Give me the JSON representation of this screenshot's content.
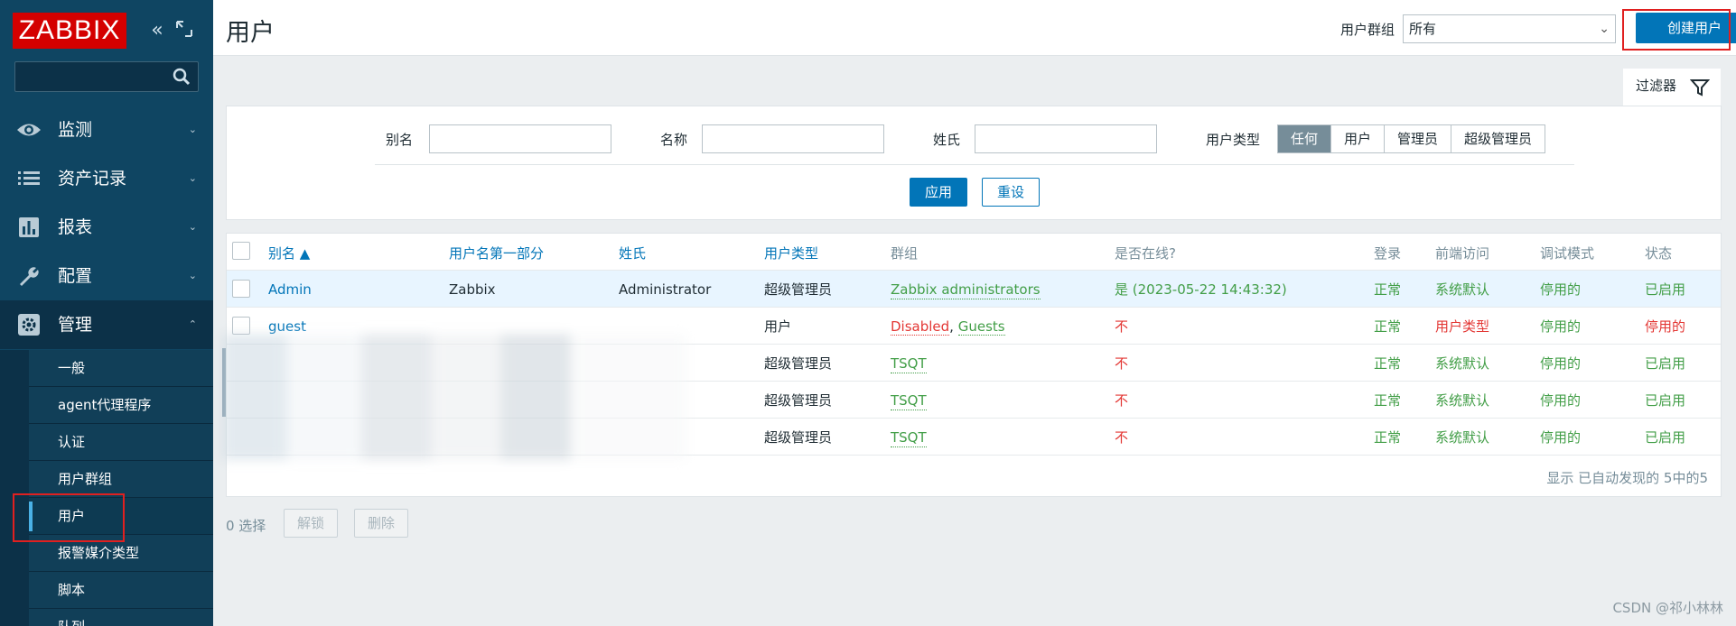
{
  "sidebar": {
    "logo": "ZABBIX",
    "search": {
      "value": "",
      "placeholder": ""
    },
    "menu": [
      {
        "label": "监测",
        "icon": "eye-icon"
      },
      {
        "label": "资产记录",
        "icon": "list-icon"
      },
      {
        "label": "报表",
        "icon": "bar-chart-icon"
      },
      {
        "label": "配置",
        "icon": "wrench-icon"
      },
      {
        "label": "管理",
        "icon": "gear-icon"
      }
    ],
    "submenu": [
      "一般",
      "agent代理程序",
      "认证",
      "用户群组",
      "用户",
      "报警媒介类型",
      "脚本",
      "队列"
    ]
  },
  "header": {
    "title": "用户",
    "group_label": "用户群组",
    "group_value": "所有",
    "create_label": "创建用户"
  },
  "filter": {
    "tab_label": "过滤器",
    "alias_label": "别名",
    "name_label": "名称",
    "surname_label": "姓氏",
    "type_label": "用户类型",
    "type_options": [
      "任何",
      "用户",
      "管理员",
      "超级管理员"
    ],
    "apply": "应用",
    "reset": "重设"
  },
  "table": {
    "headers": [
      "别名 ▲",
      "用户名第一部分",
      "姓氏",
      "用户类型",
      "群组",
      "是否在线?",
      "登录",
      "前端访问",
      "调试模式",
      "状态"
    ],
    "rows": [
      {
        "alias": "Admin",
        "name": "Zabbix",
        "surname": "Administrator",
        "type": "超级管理员",
        "group": "Zabbix administrators",
        "online": "是 (2023-05-22 14:43:32)",
        "login": "正常",
        "frontend": "系统默认",
        "debug": "停用的",
        "status": "已启用"
      },
      {
        "alias": "guest",
        "name": "",
        "surname": "",
        "type": "用户",
        "group_a": "Disabled",
        "group_sep": ",",
        "group_b": "Guests",
        "online": "不",
        "login": "正常",
        "frontend": "用户类型",
        "debug": "停用的",
        "status": "停用的"
      },
      {
        "alias": "",
        "name": "",
        "surname": "",
        "type": "超级管理员",
        "group": "TSQT",
        "online": "不",
        "login": "正常",
        "frontend": "系统默认",
        "debug": "停用的",
        "status": "已启用"
      },
      {
        "alias": "",
        "name": "",
        "surname": "",
        "type": "超级管理员",
        "group": "TSQT",
        "online": "不",
        "login": "正常",
        "frontend": "系统默认",
        "debug": "停用的",
        "status": "已启用"
      },
      {
        "alias": "",
        "name": "",
        "surname": "",
        "type": "超级管理员",
        "group": "TSQT",
        "online": "不",
        "login": "正常",
        "frontend": "系统默认",
        "debug": "停用的",
        "status": "已启用"
      }
    ],
    "footer": "显示 已自动发现的 5中的5"
  },
  "bulk": {
    "selected": "0 选择",
    "unblock": "解锁",
    "delete": "删除"
  },
  "watermark": "CSDN @祁小林林",
  "colors": {
    "sidebar": "#0f4562",
    "accent": "#0275b8",
    "green": "#429e47",
    "red": "#e33734",
    "logo": "#d40000"
  }
}
